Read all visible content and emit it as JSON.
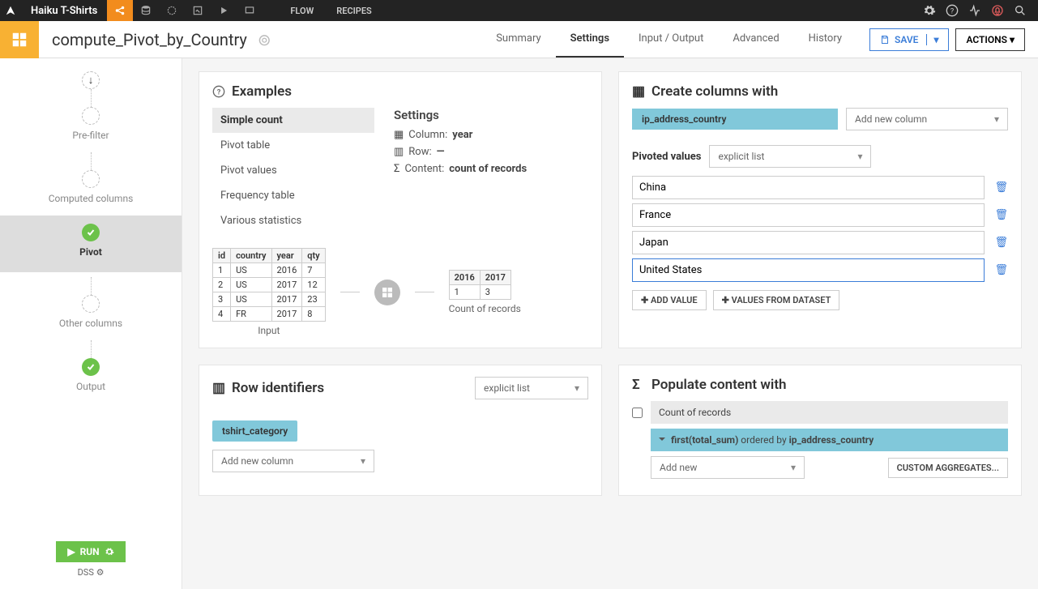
{
  "topnav": {
    "project": "Haiku T-Shirts",
    "flow": "FLOW",
    "recipes": "RECIPES"
  },
  "header": {
    "title": "compute_Pivot_by_Country",
    "tabs": {
      "summary": "Summary",
      "settings": "Settings",
      "io": "Input / Output",
      "advanced": "Advanced",
      "history": "History"
    },
    "save": "SAVE",
    "actions": "ACTIONS"
  },
  "leftrail": {
    "prefilter": "Pre-filter",
    "computed": "Computed columns",
    "pivot": "Pivot",
    "other": "Other columns",
    "output": "Output",
    "run": "RUN",
    "dss": "DSS"
  },
  "examples": {
    "title": "Examples",
    "list": {
      "simple_count": "Simple count",
      "pivot_table": "Pivot table",
      "pivot_values": "Pivot values",
      "frequency_table": "Frequency table",
      "various_stats": "Various statistics"
    },
    "settings_label": "Settings",
    "column_k": "Column:",
    "column_v": "year",
    "row_k": "Row:",
    "row_v": "—",
    "content_k": "Content:",
    "content_v": "count of records",
    "input_label": "Input",
    "output_label": "Count of records",
    "intbl_headers": {
      "id": "id",
      "country": "country",
      "year": "year",
      "qty": "qty"
    },
    "intbl_rows": [
      {
        "id": "1",
        "country": "US",
        "year": "2016",
        "qty": "7"
      },
      {
        "id": "2",
        "country": "US",
        "year": "2017",
        "qty": "12"
      },
      {
        "id": "3",
        "country": "US",
        "year": "2017",
        "qty": "23"
      },
      {
        "id": "4",
        "country": "FR",
        "year": "2017",
        "qty": "8"
      }
    ],
    "outtbl_headers": {
      "a": "2016",
      "b": "2017"
    },
    "outtbl_row": {
      "a": "1",
      "b": "3"
    }
  },
  "rowid": {
    "title": "Row identifiers",
    "mode": "explicit list",
    "chip": "tshirt_category",
    "add": "Add new column"
  },
  "createcols": {
    "title": "Create columns with",
    "chip": "ip_address_country",
    "add": "Add new column",
    "pivoted_label": "Pivoted values",
    "pivoted_mode": "explicit list",
    "values": [
      "China",
      "France",
      "Japan",
      "United States"
    ],
    "add_value": "ADD VALUE",
    "values_from_dataset": "VALUES FROM DATASET"
  },
  "populate": {
    "title": "Populate content with",
    "count_label": "Count of records",
    "agg_prefix": "first(total_sum)",
    "agg_mid": " ordered by ",
    "agg_col": "ip_address_country",
    "add_new": "Add new",
    "custom": "CUSTOM AGGREGATES..."
  }
}
